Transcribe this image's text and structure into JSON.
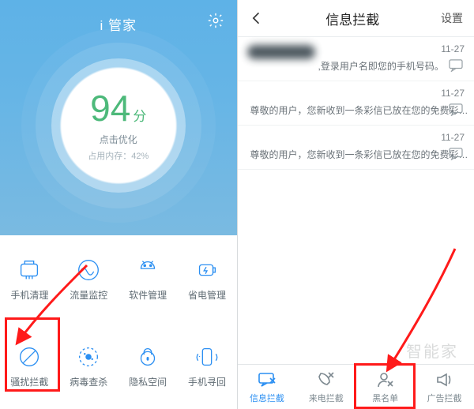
{
  "left": {
    "title": "i 管家",
    "score": "94",
    "score_unit": "分",
    "hint": "点击优化",
    "memory": "占用内存：42%",
    "features": [
      {
        "label": "手机清理",
        "icon": "broom-icon"
      },
      {
        "label": "流量监控",
        "icon": "wave-icon"
      },
      {
        "label": "软件管理",
        "icon": "android-icon"
      },
      {
        "label": "省电管理",
        "icon": "battery-icon"
      },
      {
        "label": "骚扰拦截",
        "icon": "block-icon"
      },
      {
        "label": "病毒查杀",
        "icon": "virus-icon"
      },
      {
        "label": "隐私空间",
        "icon": "lock-icon"
      },
      {
        "label": "手机寻回",
        "icon": "locate-icon"
      }
    ]
  },
  "right": {
    "title": "信息拦截",
    "settings": "设置",
    "messages": [
      {
        "preview": ",登录用户名即您的手机号码。",
        "time": "11-27"
      },
      {
        "preview": "尊敬的用户，您新收到一条彩信已放在您的免费彩…",
        "time": "11-27"
      },
      {
        "preview": "尊敬的用户，您新收到一条彩信已放在您的免费彩…",
        "time": "11-27"
      }
    ],
    "tabs": [
      {
        "label": "信息拦截",
        "icon": "msg-block-icon",
        "active": true
      },
      {
        "label": "来电拦截",
        "icon": "call-block-icon",
        "active": false
      },
      {
        "label": "黑名单",
        "icon": "blacklist-icon",
        "active": false
      },
      {
        "label": "广告拦截",
        "icon": "ad-block-icon",
        "active": false
      }
    ]
  },
  "watermark": "智能家"
}
